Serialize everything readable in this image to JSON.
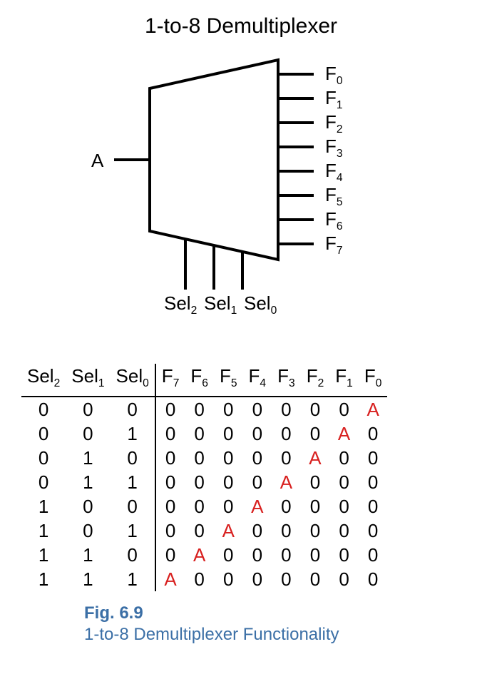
{
  "title": "1-to-8 Demultiplexer",
  "input_label": "A",
  "outputs": [
    {
      "base": "F",
      "sub": "0"
    },
    {
      "base": "F",
      "sub": "1"
    },
    {
      "base": "F",
      "sub": "2"
    },
    {
      "base": "F",
      "sub": "3"
    },
    {
      "base": "F",
      "sub": "4"
    },
    {
      "base": "F",
      "sub": "5"
    },
    {
      "base": "F",
      "sub": "6"
    },
    {
      "base": "F",
      "sub": "7"
    }
  ],
  "selects": [
    {
      "base": "Sel",
      "sub": "2"
    },
    {
      "base": "Sel",
      "sub": "1"
    },
    {
      "base": "Sel",
      "sub": "0"
    }
  ],
  "table": {
    "sel_headers": [
      {
        "base": "Sel",
        "sub": "2"
      },
      {
        "base": "Sel",
        "sub": "1"
      },
      {
        "base": "Sel",
        "sub": "0"
      }
    ],
    "out_headers": [
      {
        "base": "F",
        "sub": "7"
      },
      {
        "base": "F",
        "sub": "6"
      },
      {
        "base": "F",
        "sub": "5"
      },
      {
        "base": "F",
        "sub": "4"
      },
      {
        "base": "F",
        "sub": "3"
      },
      {
        "base": "F",
        "sub": "2"
      },
      {
        "base": "F",
        "sub": "1"
      },
      {
        "base": "F",
        "sub": "0"
      }
    ],
    "rows": [
      {
        "sel": [
          "0",
          "0",
          "0"
        ],
        "out": [
          "0",
          "0",
          "0",
          "0",
          "0",
          "0",
          "0",
          "A"
        ],
        "hl": 7
      },
      {
        "sel": [
          "0",
          "0",
          "1"
        ],
        "out": [
          "0",
          "0",
          "0",
          "0",
          "0",
          "0",
          "A",
          "0"
        ],
        "hl": 6
      },
      {
        "sel": [
          "0",
          "1",
          "0"
        ],
        "out": [
          "0",
          "0",
          "0",
          "0",
          "0",
          "A",
          "0",
          "0"
        ],
        "hl": 5
      },
      {
        "sel": [
          "0",
          "1",
          "1"
        ],
        "out": [
          "0",
          "0",
          "0",
          "0",
          "A",
          "0",
          "0",
          "0"
        ],
        "hl": 4
      },
      {
        "sel": [
          "1",
          "0",
          "0"
        ],
        "out": [
          "0",
          "0",
          "0",
          "A",
          "0",
          "0",
          "0",
          "0"
        ],
        "hl": 3
      },
      {
        "sel": [
          "1",
          "0",
          "1"
        ],
        "out": [
          "0",
          "0",
          "A",
          "0",
          "0",
          "0",
          "0",
          "0"
        ],
        "hl": 2
      },
      {
        "sel": [
          "1",
          "1",
          "0"
        ],
        "out": [
          "0",
          "A",
          "0",
          "0",
          "0",
          "0",
          "0",
          "0"
        ],
        "hl": 1
      },
      {
        "sel": [
          "1",
          "1",
          "1"
        ],
        "out": [
          "A",
          "0",
          "0",
          "0",
          "0",
          "0",
          "0",
          "0"
        ],
        "hl": 0
      }
    ]
  },
  "caption": {
    "label": "Fig. 6.9",
    "title": "1-to-8 Demultiplexer Functionality"
  }
}
